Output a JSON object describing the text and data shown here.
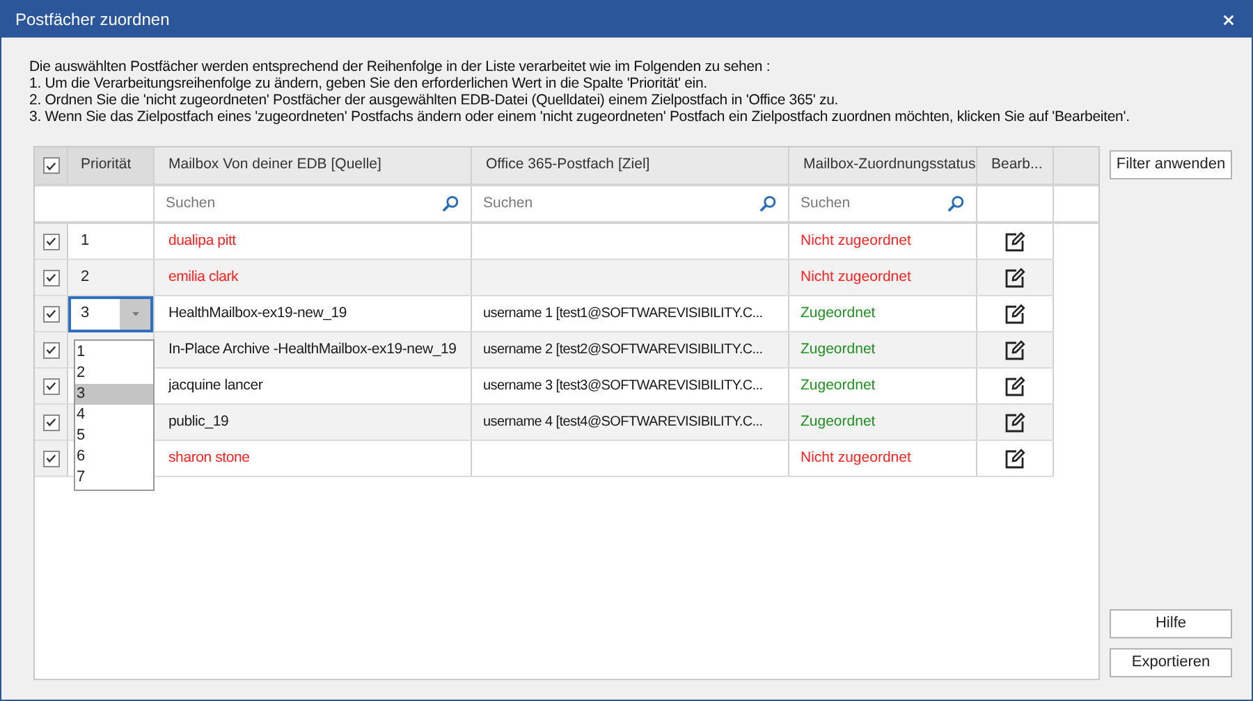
{
  "window": {
    "title": "Postfächer zuordnen"
  },
  "instructions": [
    "Die auswählten Postfächer werden entsprechend der Reihenfolge in der Liste verarbeitet wie im Folgenden zu sehen :",
    "1. Um die Verarbeitungsreihenfolge zu ändern, geben Sie den erforderlichen Wert in die Spalte 'Priorität' ein.",
    "2. Ordnen Sie die 'nicht zugeordneten' Postfächer der ausgewählten EDB-Datei (Quelldatei) einem Zielpostfach in 'Office 365' zu.",
    "3. Wenn Sie das Zielpostfach eines 'zugeordneten' Postfachs ändern oder einem 'nicht zugeordneten' Postfach ein Zielpostfach zuordnen möchten, klicken Sie auf 'Bearbeiten'."
  ],
  "table": {
    "header_checked": true,
    "columns": [
      "Priorität",
      "Mailbox Von deiner EDB [Quelle]",
      "Office 365-Postfach [Ziel]",
      "Mailbox-Zuordnungsstatus",
      "Bearb..."
    ],
    "search_placeholders": [
      "Suchen",
      "Suchen",
      "Suchen"
    ],
    "rows": [
      {
        "checked": true,
        "priority": "1",
        "editing": false,
        "mailbox": "dualipa pitt",
        "target": "",
        "status": "Nicht zugeordnet",
        "mapped": false
      },
      {
        "checked": true,
        "priority": "2",
        "editing": false,
        "mailbox": "emilia clark",
        "target": "",
        "status": "Nicht zugeordnet",
        "mapped": false
      },
      {
        "checked": true,
        "priority": "3",
        "editing": true,
        "mailbox": "HealthMailbox-ex19-new_19",
        "target": "username 1 [test1@SOFTWAREVISIBILITY.C...",
        "status": "Zugeordnet",
        "mapped": true
      },
      {
        "checked": true,
        "mailbox": "In-Place Archive -HealthMailbox-ex19-new_19",
        "target": "username 2 [test2@SOFTWAREVISIBILITY.C...",
        "status": "Zugeordnet",
        "mapped": true
      },
      {
        "checked": true,
        "mailbox": "jacquine lancer",
        "target": "username 3 [test3@SOFTWAREVISIBILITY.C...",
        "status": "Zugeordnet",
        "mapped": true
      },
      {
        "checked": true,
        "mailbox": "public_19",
        "target": "username 4 [test4@SOFTWAREVISIBILITY.C...",
        "status": "Zugeordnet",
        "mapped": true
      },
      {
        "checked": true,
        "mailbox": "sharon stone",
        "target": "",
        "status": "Nicht zugeordnet",
        "mapped": false
      }
    ]
  },
  "priority_dropdown": {
    "options": [
      {
        "label": "1",
        "selected": false
      },
      {
        "label": "2",
        "selected": false
      },
      {
        "label": "3",
        "selected": true
      },
      {
        "label": "4",
        "selected": false
      },
      {
        "label": "5",
        "selected": false
      },
      {
        "label": "6",
        "selected": false
      },
      {
        "label": "7",
        "selected": false
      }
    ]
  },
  "buttons": {
    "filter": "Filter anwenden",
    "help": "Hilfe",
    "export": "Exportieren"
  }
}
